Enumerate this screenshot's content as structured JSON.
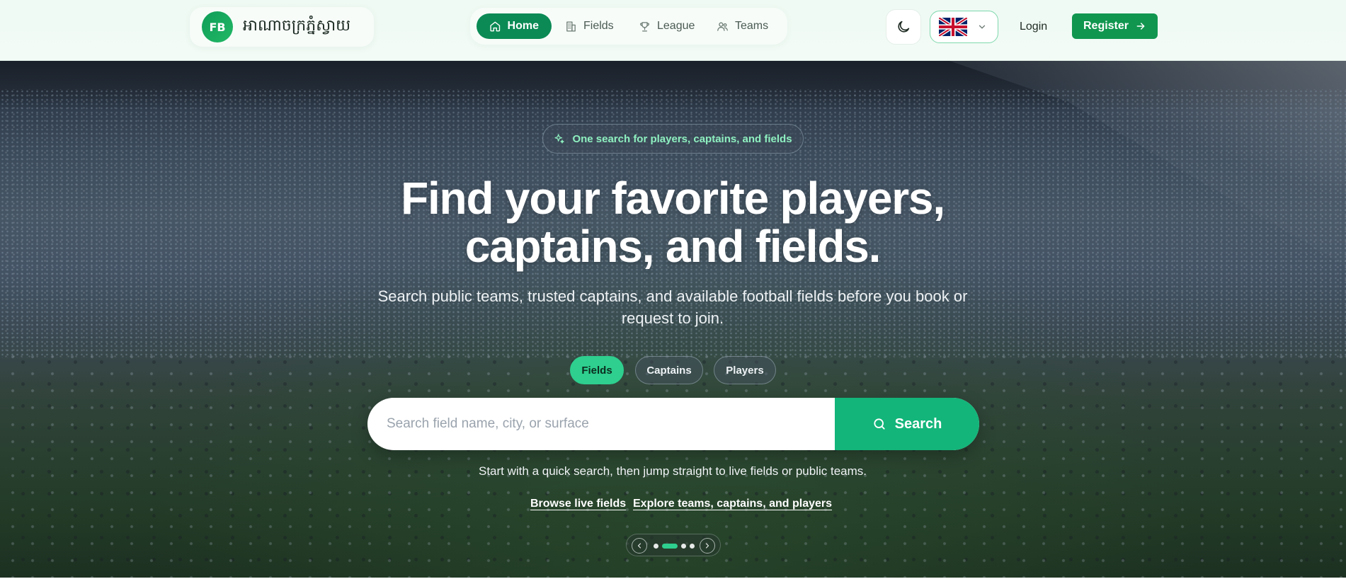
{
  "brand": {
    "logo_text": "FB",
    "name": "អាណាចក្រភ្នំស្វាយ"
  },
  "nav": {
    "items": [
      {
        "label": "Home",
        "icon": "home-icon",
        "active": true
      },
      {
        "label": "Fields",
        "icon": "building-icon",
        "active": false
      },
      {
        "label": "League",
        "icon": "trophy-icon",
        "active": false
      },
      {
        "label": "Teams",
        "icon": "users-icon",
        "active": false
      }
    ]
  },
  "header_actions": {
    "theme_icon": "moon-icon",
    "language_flag": "uk-flag-icon",
    "login_label": "Login",
    "register_label": "Register"
  },
  "hero": {
    "badge": "One search for players, captains, and fields",
    "headline_line1": "Find your favorite players,",
    "headline_line2": "captains, and fields.",
    "subhead": "Search public teams, trusted captains, and available football fields before you book or request to join.",
    "tabs": [
      {
        "label": "Fields",
        "active": true
      },
      {
        "label": "Captains",
        "active": false
      },
      {
        "label": "Players",
        "active": false
      }
    ],
    "search": {
      "placeholder": "Search field name, city, or surface",
      "value": "",
      "button_label": "Search"
    },
    "hint": "Start with a quick search, then jump straight to live fields or public teams.",
    "links": [
      {
        "label": "Browse live fields"
      },
      {
        "label": "Explore teams, captains, and players"
      }
    ],
    "carousel": {
      "slide_count": 4,
      "active_index": 2
    }
  },
  "colors": {
    "brand_green": "#0b8a55",
    "register_green": "#10964f",
    "accent_mint": "#2ecf8f",
    "search_green": "#13b57a"
  }
}
